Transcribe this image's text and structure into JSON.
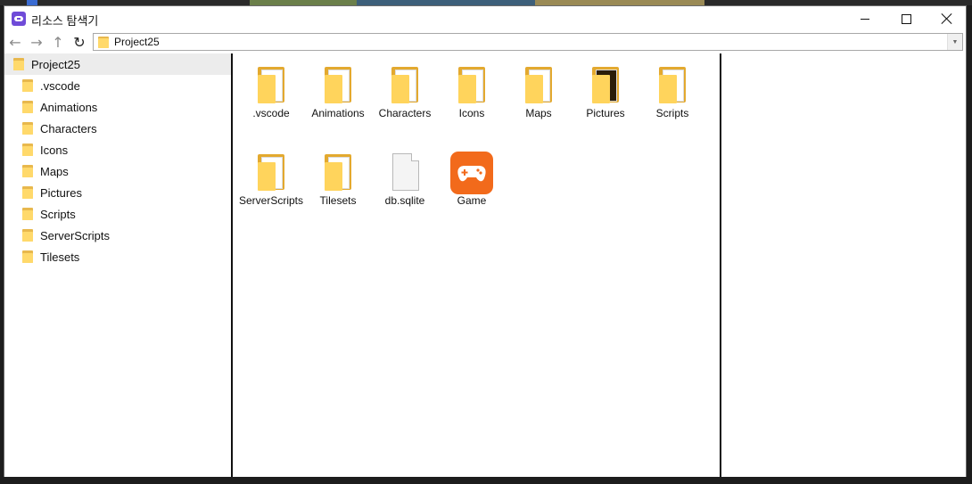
{
  "window": {
    "title": "리소스 탐색기"
  },
  "address": {
    "path": "Project25"
  },
  "tree": {
    "root": "Project25",
    "children": [
      ".vscode",
      "Animations",
      "Characters",
      "Icons",
      "Maps",
      "Pictures",
      "Scripts",
      "ServerScripts",
      "Tilesets"
    ]
  },
  "files": [
    {
      "name": ".vscode",
      "icon": "folder-icon"
    },
    {
      "name": "Animations",
      "icon": "folder-icon"
    },
    {
      "name": "Characters",
      "icon": "folder-icon"
    },
    {
      "name": "Icons",
      "icon": "folder-icon"
    },
    {
      "name": "Maps",
      "icon": "folder-icon"
    },
    {
      "name": "Pictures",
      "icon": "folder-icon"
    },
    {
      "name": "Scripts",
      "icon": "folder-icon"
    },
    {
      "name": "ServerScripts",
      "icon": "folder-icon"
    },
    {
      "name": "Tilesets",
      "icon": "folder-icon"
    },
    {
      "name": "db.sqlite",
      "icon": "file-icon"
    },
    {
      "name": "Game",
      "icon": "game-controller-icon"
    }
  ],
  "colors": {
    "folder": "#ffd45c",
    "folder_back": "#e3a92f",
    "accent": "#6f4bd8",
    "game": "#f26a1b",
    "selected": "#ececec"
  }
}
